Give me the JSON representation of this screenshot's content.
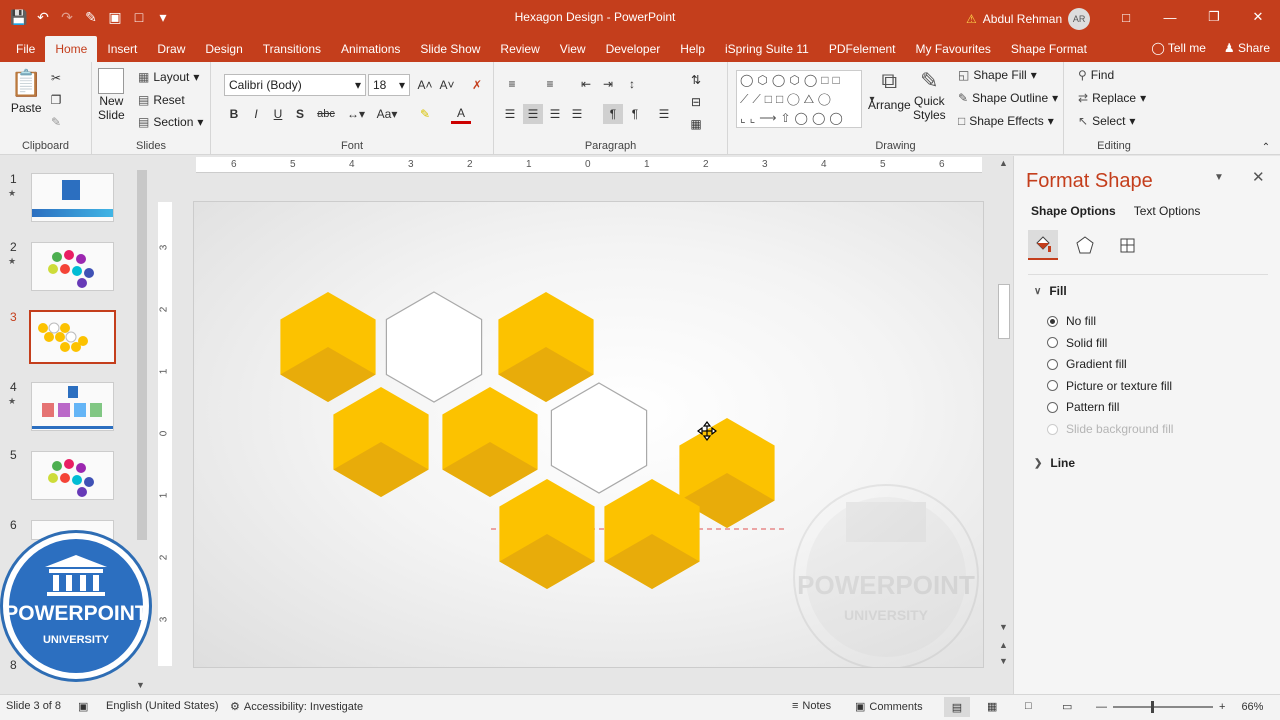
{
  "window": {
    "title": "Hexagon Design  -  PowerPoint",
    "user_name": "Abdul Rehman",
    "user_initials": "AR"
  },
  "tabs": [
    "File",
    "Home",
    "Insert",
    "Draw",
    "Design",
    "Transitions",
    "Animations",
    "Slide Show",
    "Review",
    "View",
    "Developer",
    "Help",
    "iSpring Suite 11",
    "PDFelement",
    "My Favourites",
    "Shape Format"
  ],
  "active_tab": "Home",
  "tell_me": "Tell me",
  "share": "Share",
  "ribbon": {
    "clipboard": {
      "label": "Clipboard",
      "paste": "Paste"
    },
    "slides": {
      "label": "Slides",
      "new_slide_1": "New",
      "new_slide_2": "Slide",
      "layout": "Layout",
      "reset": "Reset",
      "section": "Section"
    },
    "font": {
      "label": "Font",
      "family": "Calibri (Body)",
      "size": "18",
      "bold": "B",
      "italic": "I",
      "underline": "U",
      "strike": "S",
      "abc": "abc",
      "aa": "Aa"
    },
    "paragraph": {
      "label": "Paragraph"
    },
    "drawing": {
      "label": "Drawing",
      "arrange": "Arrange",
      "quick_1": "Quick",
      "quick_2": "Styles",
      "shape_fill": "Shape Fill",
      "shape_outline": "Shape Outline",
      "shape_effects": "Shape Effects"
    },
    "editing": {
      "label": "Editing",
      "find": "Find",
      "replace": "Replace",
      "select": "Select"
    }
  },
  "slides_panel": {
    "numbers": [
      "1",
      "2",
      "3",
      "4",
      "5",
      "6",
      "8"
    ],
    "active": "3"
  },
  "ruler": {
    "h_ticks": [
      "6",
      "5",
      "4",
      "3",
      "2",
      "1",
      "0",
      "1",
      "2",
      "3",
      "4",
      "5",
      "6"
    ],
    "v_ticks": [
      "3",
      "2",
      "1",
      "0",
      "1",
      "2",
      "3"
    ]
  },
  "slide_hexagons": [
    {
      "fill": "yellow"
    },
    {
      "fill": "none"
    },
    {
      "fill": "yellow"
    },
    {
      "fill": "yellow"
    },
    {
      "fill": "yellow"
    },
    {
      "fill": "none"
    },
    {
      "fill": "yellow"
    },
    {
      "fill": "yellow"
    },
    {
      "fill": "yellow"
    }
  ],
  "colors": {
    "accent": "#c43e1c",
    "hex_light": "#fcc200",
    "hex_dark": "#e8ac0a"
  },
  "watermark": {
    "line1": "POWERPOINT",
    "line2": "UNIVERSITY"
  },
  "logo": {
    "line1": "POWERPOINT",
    "line2": "UNIVERSITY"
  },
  "format_pane": {
    "title": "Format Shape",
    "tabs": [
      "Shape Options",
      "Text Options"
    ],
    "fill_section": "Fill",
    "options": [
      {
        "label": "No fill",
        "selected": true,
        "disabled": false
      },
      {
        "label": "Solid fill",
        "selected": false,
        "disabled": false
      },
      {
        "label": "Gradient fill",
        "selected": false,
        "disabled": false
      },
      {
        "label": "Picture or texture fill",
        "selected": false,
        "disabled": false
      },
      {
        "label": "Pattern fill",
        "selected": false,
        "disabled": false
      },
      {
        "label": "Slide background fill",
        "selected": false,
        "disabled": true
      }
    ],
    "line_section": "Line"
  },
  "status": {
    "slide": "Slide 3 of 8",
    "language": "English (United States)",
    "accessibility": "Accessibility: Investigate",
    "notes": "Notes",
    "comments": "Comments",
    "zoom": "66%"
  }
}
